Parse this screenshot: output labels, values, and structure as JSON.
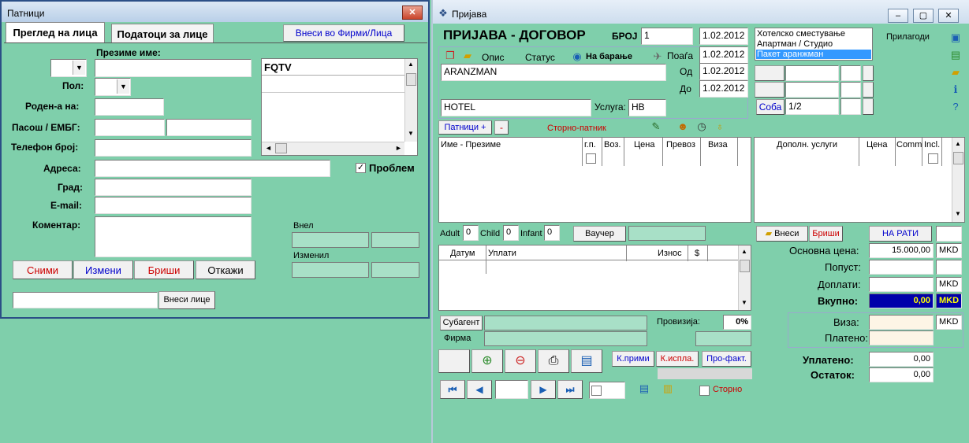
{
  "win1": {
    "title": "Патници",
    "close_label": "✕",
    "tabs": [
      "Преглед на лица",
      "Податоци за лице"
    ],
    "vnesi_firmi_label": "Внеси во Фирми/Лица",
    "labels": {
      "prezime_ime": "Презиме име:",
      "pol": "Пол:",
      "roden": "Роден-а на:",
      "pasos": "Пасош / ЕМБГ:",
      "telefon": "Телефон број:",
      "adresa": "Адреса:",
      "grad": "Град:",
      "email": "E-mail:",
      "komentar": "Коментар:",
      "vnel": "Внел",
      "izmenil": "Изменил",
      "problem": "Проблем"
    },
    "list_header": "FQTV",
    "buttons": {
      "snimi": "Сними",
      "izmeni": "Измени",
      "brishi": "Бриши",
      "otkazhi": "Откажи"
    },
    "vnesi_lice_label": "Внеси лице",
    "problem_checked": "✓"
  },
  "win2": {
    "title": "Пријава",
    "main_title": "ПРИЈАВА - ДОГОВОР",
    "broj_label": "БРОЈ",
    "broj_value": "1",
    "date_value": "1.02.2012",
    "services_list": [
      "Хотелско сместување",
      "Апартман / Студио",
      "Пакет аранжман"
    ],
    "prilagodi_label": "Прилагоди",
    "opis_label": "Опис",
    "status_label": "Статус",
    "na_baranje_label": "На барање",
    "poagja_label": "Поаѓа",
    "od_label": "Од",
    "do_label": "До",
    "poagja_value": "1.02.2012",
    "od_value": "1.02.2012",
    "do_value": "1.02.2012",
    "aranzman_value": "ARANZMAN",
    "hotel_value": "HOTEL",
    "usluga_label": "Услуга:",
    "usluga_value": "HB",
    "soba_label": "Соба",
    "soba_value": "1/2",
    "patnici_plus_label": "Патници +",
    "minus_label": "-",
    "storno_patnik_label": "Сторно-патник",
    "patnici_cols": [
      "Име - Презиме",
      "г.п.",
      "Воз.",
      "Цена",
      "Превоз",
      "Виза"
    ],
    "uslugi_cols": [
      "Дополн. услуги",
      "Цена",
      "Comm",
      "Incl."
    ],
    "adult_label": "Adult",
    "adult_value": "0",
    "child_label": "Child",
    "child_value": "0",
    "infant_label": "Infant",
    "infant_value": "0",
    "vaucher_label": "Ваучер",
    "vnesi_label": "Внеси",
    "brishi_label": "Бриши",
    "na_rati_label": "НА РАТИ",
    "uplati_cols": [
      "Датум",
      "Уплати",
      "Износ",
      "$"
    ],
    "osnovna_label": "Основна цена:",
    "osnovna_value": "15.000,00",
    "popust_label": "Попуст:",
    "doplati_label": "Доплати:",
    "vkupno_label": "Вкупно:",
    "vkupno_value": "0,00",
    "currency": "MKD",
    "viza_label": "Виза:",
    "plateno_label": "Платено:",
    "uplateno_label": "Уплатено:",
    "uplateno_value": "0,00",
    "ostatok_label": "Остаток:",
    "ostatok_value": "0,00",
    "subagent_label": "Субагент",
    "firma_label": "Фирма",
    "provizija_label": "Провизија:",
    "provizija_value": "0%",
    "kprimi_label": "К.прими",
    "kispla_label": "К.испла.",
    "profakt_label": "Про-факт.",
    "storno_label": "Сторно"
  },
  "icons": [
    "close-icon",
    "minimize-icon",
    "maximize-icon",
    "app-icon",
    "print-icon",
    "document-icon",
    "folder-icon",
    "globe-icon",
    "plane-icon",
    "info-icon",
    "help-icon"
  ],
  "colors": {
    "bg": "#7fcfab",
    "accent_red": "#cc0000",
    "accent_blue": "#0000cc",
    "vkupno_bg": "#0000aa",
    "vkupno_text": "#ffff00"
  }
}
